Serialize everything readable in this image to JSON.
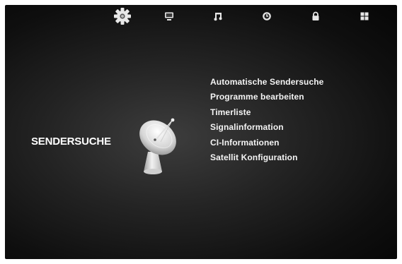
{
  "top_tabs": [
    {
      "icon": "gear-icon",
      "active": true
    },
    {
      "icon": "monitor-icon",
      "active": false
    },
    {
      "icon": "music-note-icon",
      "active": false
    },
    {
      "icon": "clock-icon",
      "active": false
    },
    {
      "icon": "lock-icon",
      "active": false
    },
    {
      "icon": "windows-grid-icon",
      "active": false
    }
  ],
  "section": {
    "title": "SENDERSUCHE",
    "icon": "satellite-dish-icon"
  },
  "menu": {
    "items": [
      {
        "label": "Automatische Sendersuche"
      },
      {
        "label": "Programme bearbeiten"
      },
      {
        "label": "Timerliste"
      },
      {
        "label": "Signalinformation"
      },
      {
        "label": "CI-Informationen"
      },
      {
        "label": "Satellit Konfiguration"
      }
    ]
  },
  "colors": {
    "background": "#1a1a1a",
    "text": "#ffffff"
  }
}
